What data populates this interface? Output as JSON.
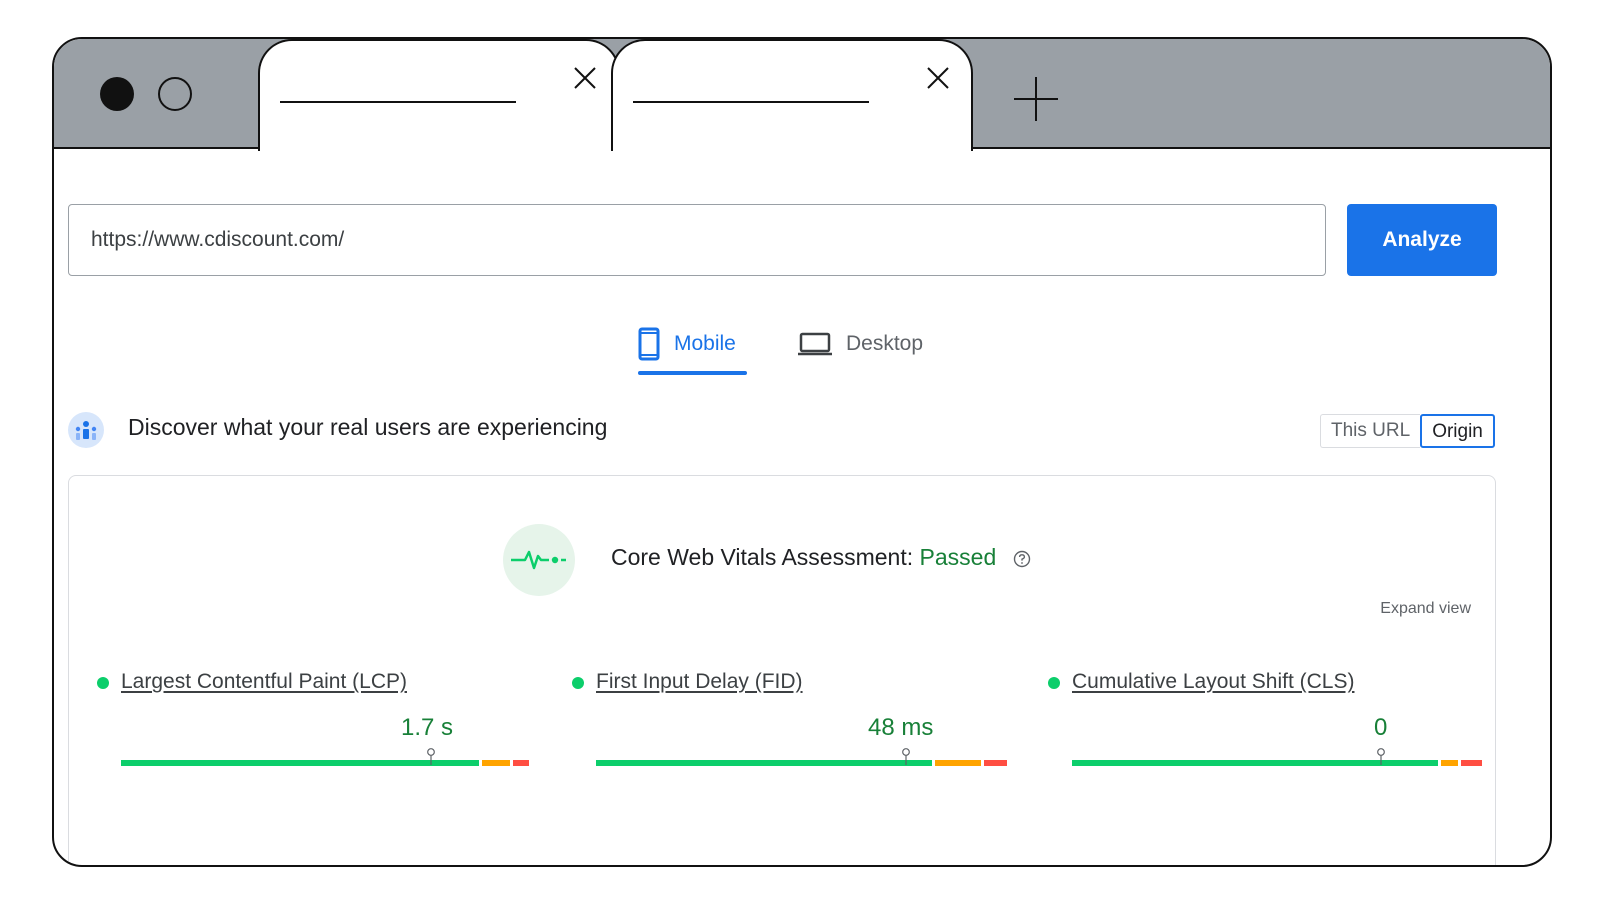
{
  "browser": {
    "tabs": [
      {
        "close_icon": "close-icon"
      },
      {
        "close_icon": "close-icon"
      }
    ],
    "new_tab_icon": "plus-icon"
  },
  "search": {
    "url_value": "https://www.cdiscount.com/",
    "analyze_label": "Analyze"
  },
  "device_tabs": [
    {
      "label": "Mobile",
      "icon": "phone-icon",
      "selected": true
    },
    {
      "label": "Desktop",
      "icon": "laptop-icon",
      "selected": false
    }
  ],
  "field_data": {
    "title": "Discover what your real users are experiencing",
    "toggle": {
      "this_url": "This URL",
      "origin": "Origin",
      "selected": "Origin"
    }
  },
  "assessment": {
    "label": "Core Web Vitals Assessment: ",
    "result": "Passed",
    "expand": "Expand view"
  },
  "metrics": [
    {
      "name": "Largest Contentful Paint (LCP)",
      "value": "1.7 s",
      "status": "good"
    },
    {
      "name": "First Input Delay (FID)",
      "value": "48 ms",
      "status": "good"
    },
    {
      "name": "Cumulative Layout Shift (CLS)",
      "value": "0",
      "status": "good"
    }
  ],
  "colors": {
    "accent": "#1a73e8",
    "good": "#0cce6b",
    "needs_improvement": "#ffa400",
    "poor": "#ff4e42",
    "passed_text": "#188038"
  }
}
